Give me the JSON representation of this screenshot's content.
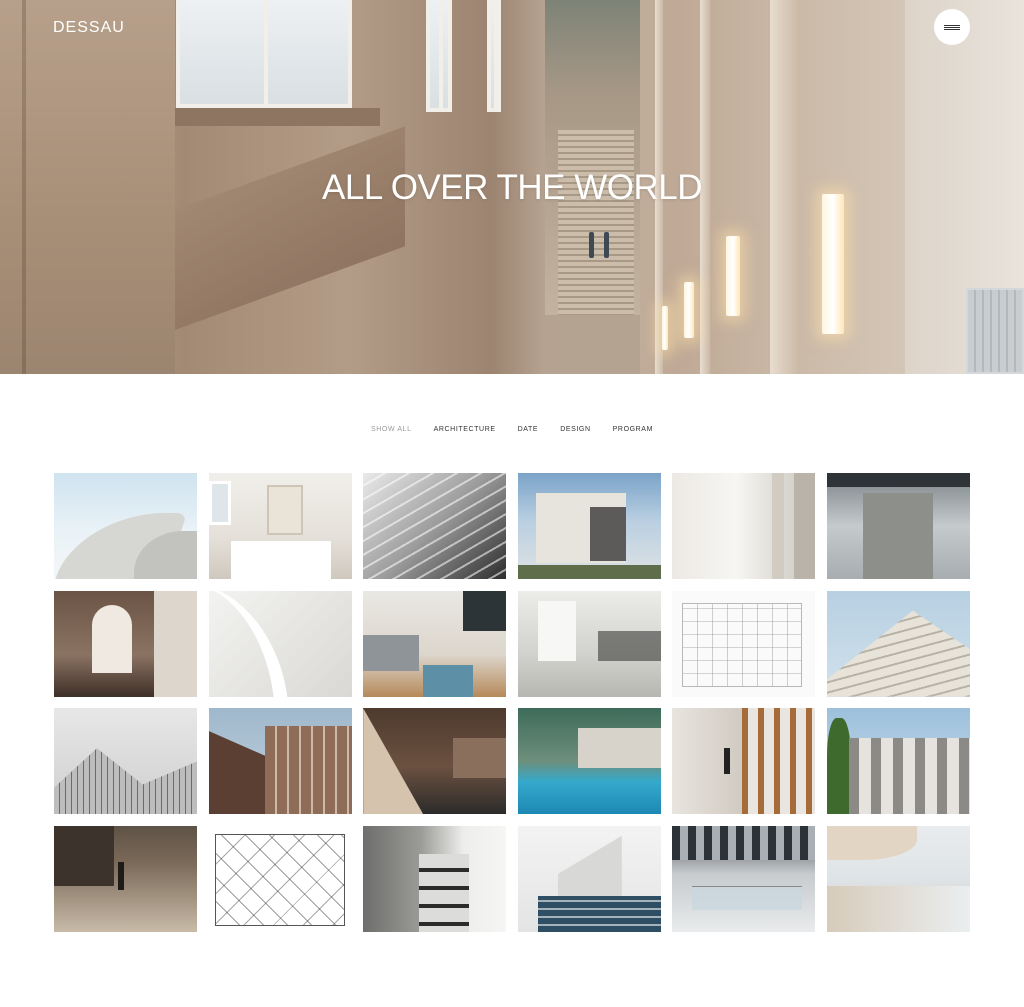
{
  "header": {
    "brand": "DESSAU",
    "menu_icon": "hamburger-icon"
  },
  "hero": {
    "title": "ALL OVER THE WORLD"
  },
  "filters": [
    {
      "label": "SHOW ALL",
      "active": true
    },
    {
      "label": "ARCHITECTURE",
      "active": false
    },
    {
      "label": "DATE",
      "active": false
    },
    {
      "label": "DESIGN",
      "active": false
    },
    {
      "label": "PROGRAM",
      "active": false
    }
  ],
  "colors": {
    "background": "#ffffff",
    "text": "#333333",
    "muted": "#9a9a9a",
    "hero_text": "#ffffff"
  }
}
